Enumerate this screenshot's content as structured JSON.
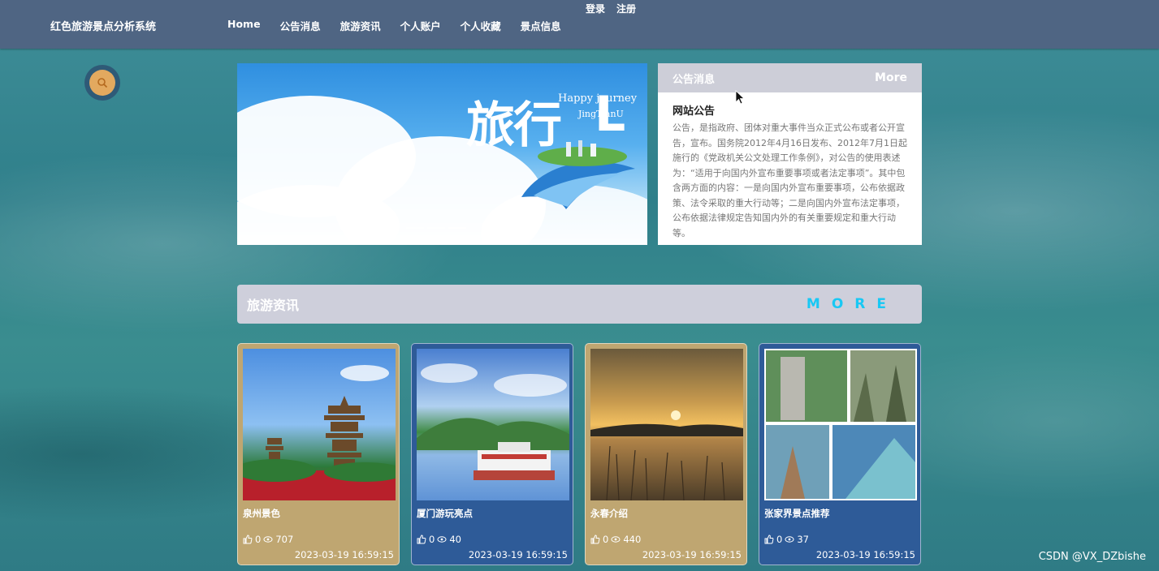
{
  "header": {
    "brand": "红色旅游景点分析系统",
    "nav": [
      "Home",
      "公告消息",
      "旅游资讯",
      "个人账户",
      "个人收藏",
      "景点信息"
    ],
    "login": "登录",
    "register": "注册"
  },
  "banner": {
    "title": "旅行",
    "title_tail": "L",
    "happy": "Happy journey",
    "jing": "JingTianU",
    "slide_count": 3,
    "active_slide": 2
  },
  "notice": {
    "heading": "公告消息",
    "more": "More",
    "title": "网站公告",
    "body": "公告，是指政府、团体对重大事件当众正式公布或者公开宣告，宣布。国务院2012年4月16日发布、2012年7月1日起施行的《党政机关公文处理工作条例》，对公告的使用表述为：“适用于向国内外宣布重要事项或者法定事项”。其中包含两方面的内容：一是向国内外宣布重要事项，公布依据政策、法令采取的重大行动等；二是向国内外宣布法定事项，公布依据法律规定告知国内外的有关重要规定和重大行动等。"
  },
  "news": {
    "title": "旅游资讯",
    "more": "MORE",
    "cards": [
      {
        "title": "泉州景色",
        "likes": "0",
        "views": "707",
        "date": "2023-03-19 16:59:15"
      },
      {
        "title": "厦门游玩亮点",
        "likes": "0",
        "views": "40",
        "date": "2023-03-19 16:59:15"
      },
      {
        "title": "永春介绍",
        "likes": "0",
        "views": "440",
        "date": "2023-03-19 16:59:15"
      },
      {
        "title": "张家界景点推荐",
        "likes": "0",
        "views": "37",
        "date": "2023-03-19 16:59:15"
      }
    ]
  },
  "watermark": "CSDN @VX_DZbishe",
  "colors": {
    "topbar": "#4f6583",
    "card_tan": "#bfa671",
    "card_blue": "#2e5b98",
    "more_accent": "#18c8f4"
  }
}
